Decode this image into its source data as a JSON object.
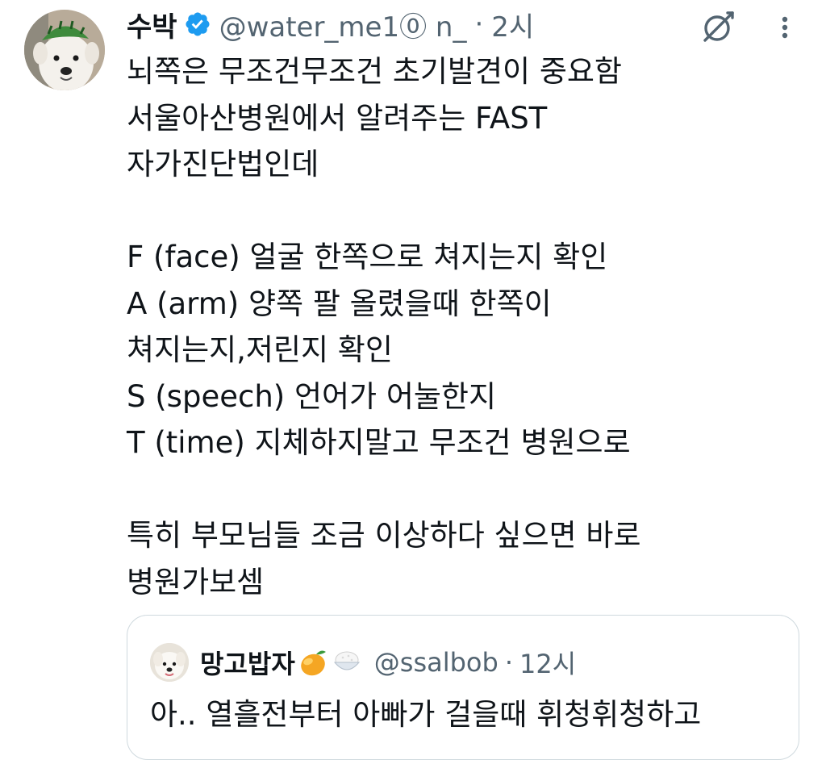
{
  "tweet": {
    "author": {
      "display_name": "수박",
      "handle": "@water_me1⓪ n_",
      "verified": true
    },
    "separator": "·",
    "time": "2시",
    "body_lines": [
      "뇌쪽은 무조건무조건 초기발견이 중요함",
      "서울아산병원에서 알려주는 FAST",
      "자가진단법인데",
      "",
      "F (face) 얼굴 한쪽으로 쳐지는지 확인",
      "A (arm) 양쪽 팔 올렸을때 한쪽이",
      "쳐지는지,저린지 확인",
      "S (speech) 언어가 어눌한지",
      "T (time) 지체하지말고 무조건 병원으로",
      "",
      "특히 부모님들 조금 이상하다 싶으면 바로",
      "병원가보셈"
    ]
  },
  "quoted": {
    "display_name": "망고밥자",
    "emojis": [
      "mango-emoji",
      "rice-bowl-emoji"
    ],
    "handle": "@ssalbob",
    "separator": "·",
    "time": "12시",
    "text": "아.. 열흘전부터 아빠가 걸을때 휘청휘청하고"
  },
  "icons": {
    "grok": "grok-icon",
    "more": "more-vertical-icon",
    "verified": "verified-badge-icon"
  },
  "colors": {
    "verified_blue": "#1d9bf0",
    "secondary_text": "#536471",
    "primary_text": "#0f1419",
    "border": "#cfd9de"
  }
}
